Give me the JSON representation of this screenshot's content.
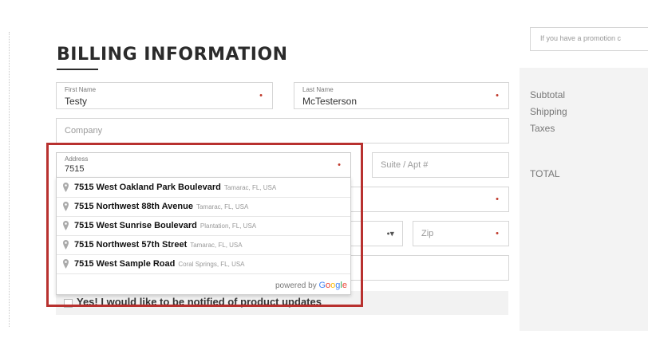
{
  "form": {
    "title": "BILLING INFORMATION",
    "first_name": {
      "label": "First Name",
      "value": "Testy"
    },
    "last_name": {
      "label": "Last Name",
      "value": "McTesterson"
    },
    "company": {
      "placeholder": "Company"
    },
    "address": {
      "label": "Address",
      "value": "7515"
    },
    "suite": {
      "placeholder": "Suite / Apt #"
    },
    "zip": {
      "placeholder": "Zip"
    },
    "required_marker": "•",
    "state_marker": "•▾",
    "notify_label": "Yes! I would like to be notified of product updates"
  },
  "autocomplete": {
    "suggestions": [
      {
        "match": "7515",
        "rest": " West Oakland Park Boulevard",
        "secondary": "Tamarac, FL, USA"
      },
      {
        "match": "7515",
        "rest": " Northwest 88th Avenue",
        "secondary": "Tamarac, FL, USA"
      },
      {
        "match": "7515",
        "rest": " West Sunrise Boulevard",
        "secondary": "Plantation, FL, USA"
      },
      {
        "match": "7515",
        "rest": " Northwest 57th Street",
        "secondary": "Tamarac, FL, USA"
      },
      {
        "match": "7515",
        "rest": " West Sample Road",
        "secondary": "Coral Springs, FL, USA"
      }
    ],
    "powered_by": "powered by",
    "google": [
      "G",
      "o",
      "o",
      "g",
      "l",
      "e"
    ],
    "google_colors": [
      "#4285F4",
      "#EA4335",
      "#FBBC05",
      "#4285F4",
      "#34A853",
      "#EA4335"
    ]
  },
  "summary": {
    "promo_placeholder": "If you have a promotion c",
    "subtotal": "Subtotal",
    "shipping": "Shipping",
    "taxes": "Taxes",
    "total": "TOTAL"
  },
  "colors": {
    "highlight": "#b8312f",
    "required": "#c0392b"
  }
}
